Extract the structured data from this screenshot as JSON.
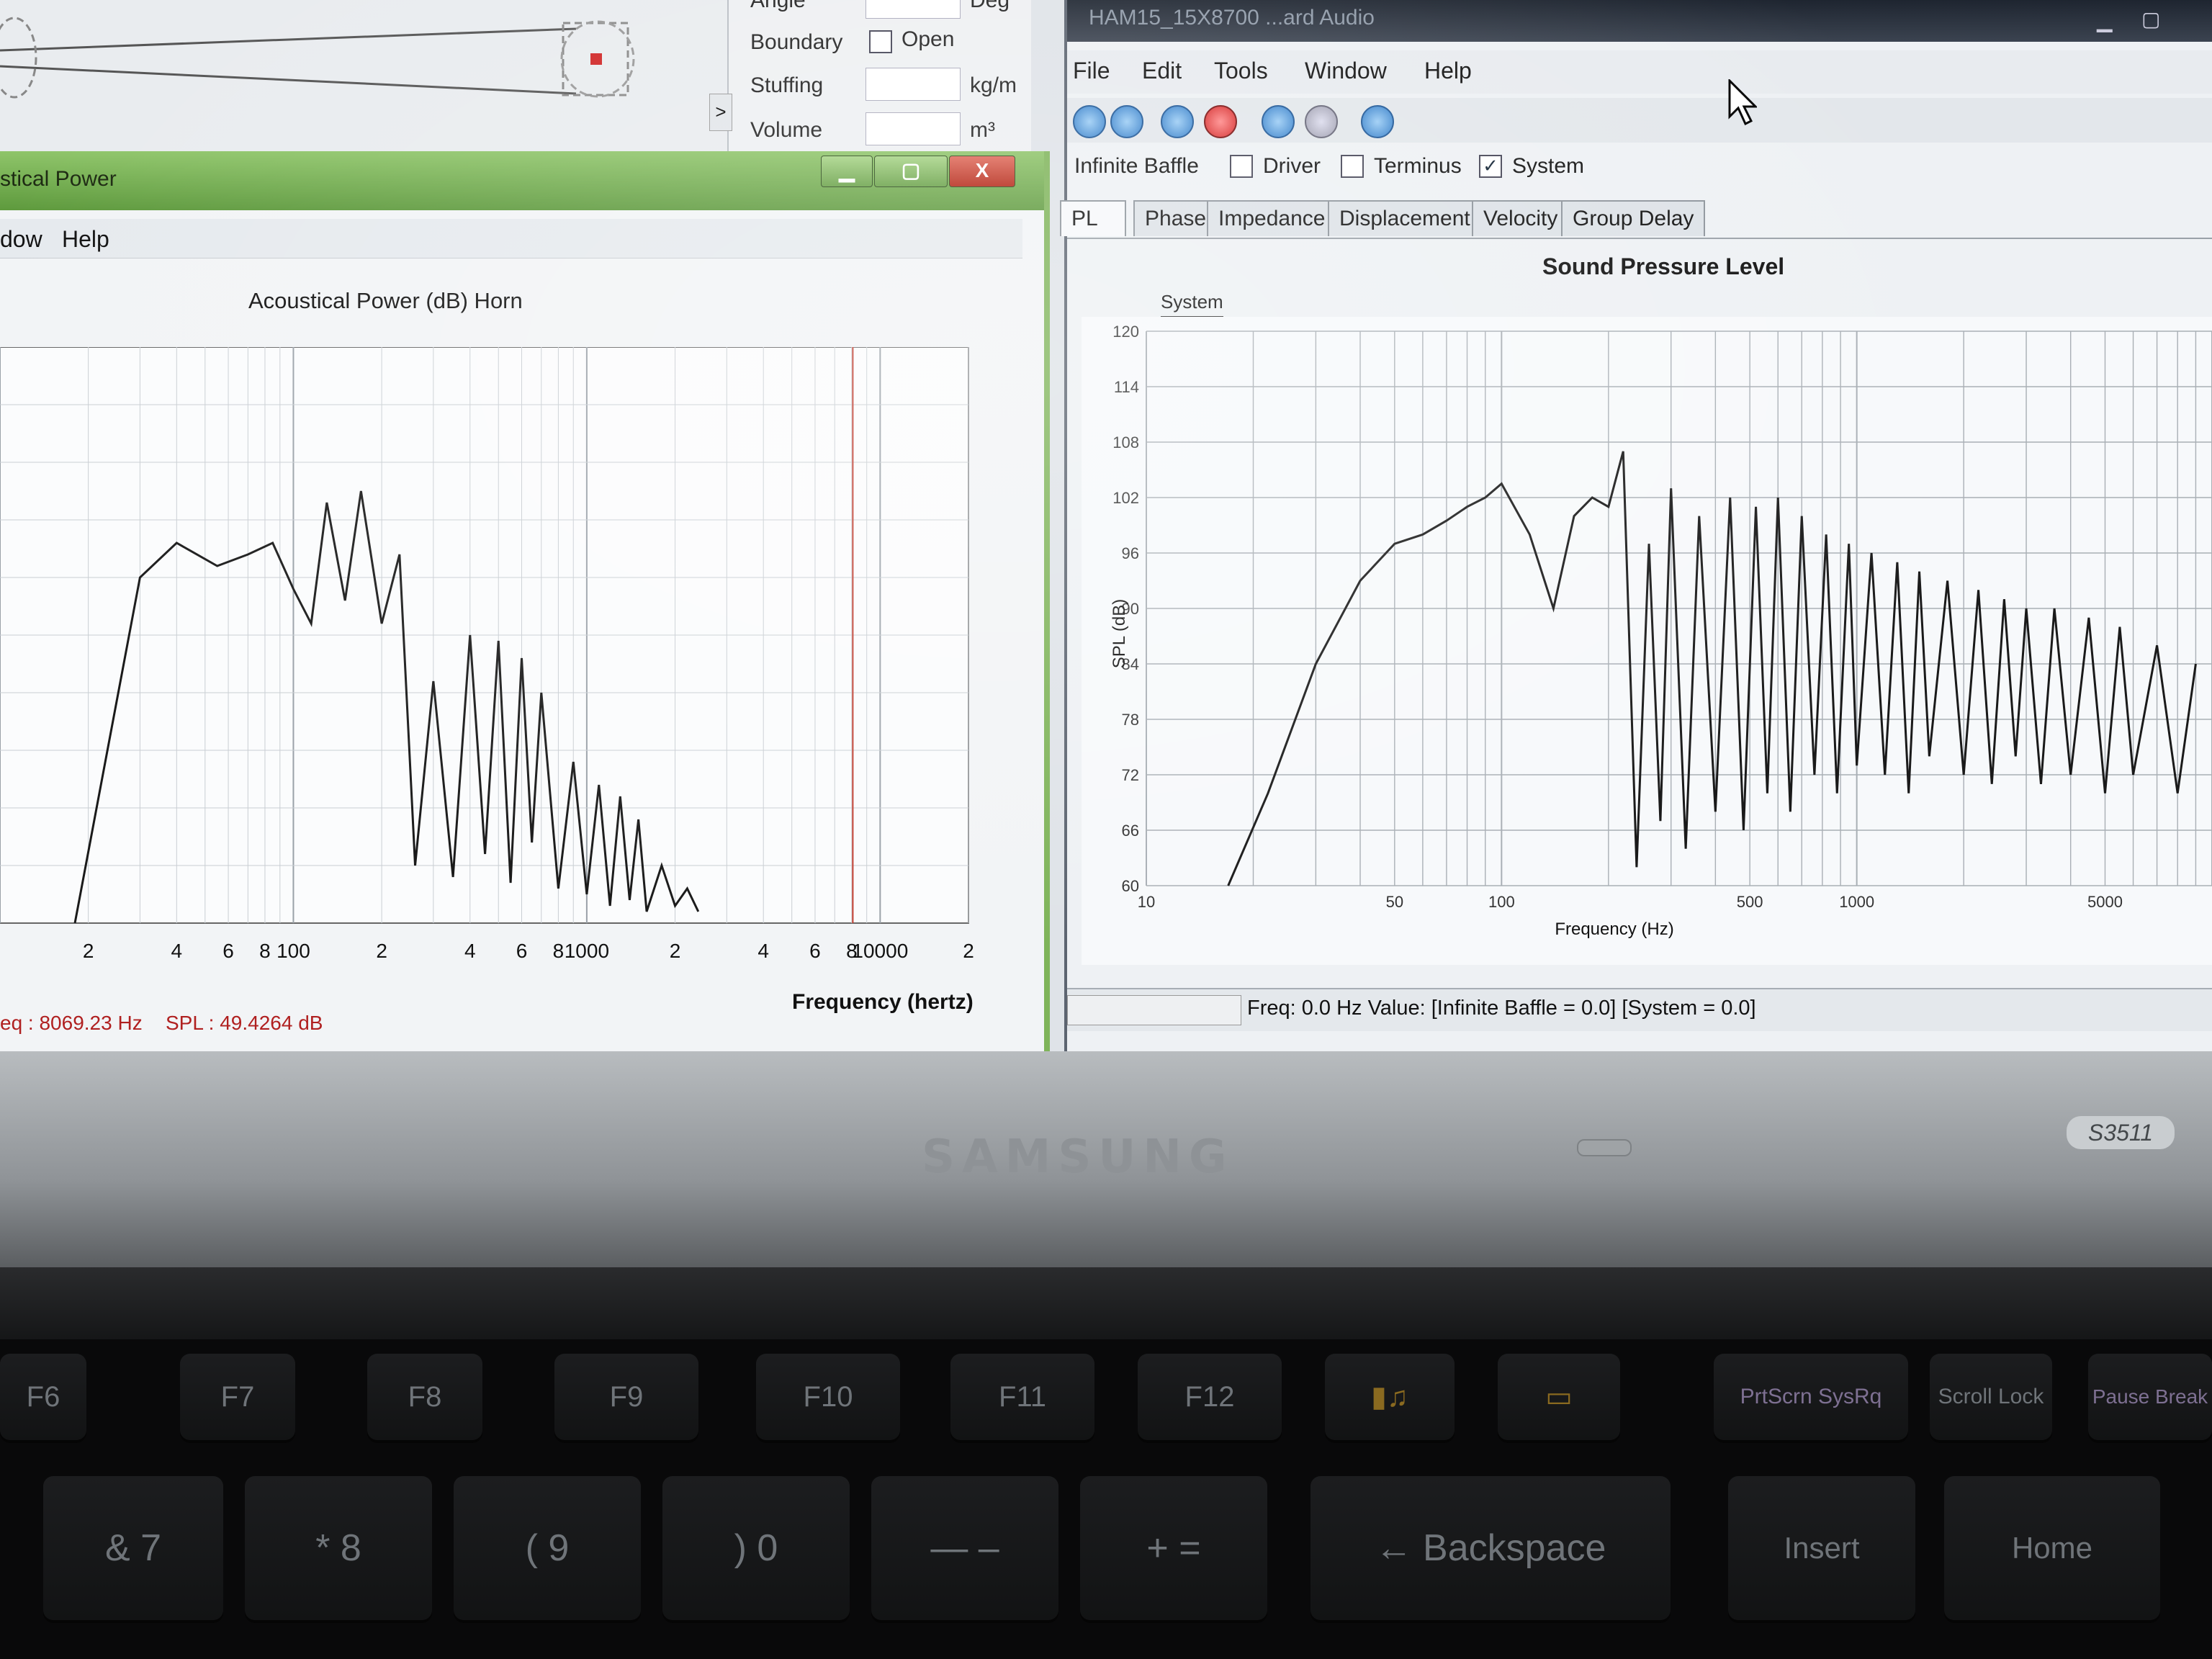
{
  "horn_panel": {
    "rows": [
      {
        "label": "Angle",
        "unit": "Deg"
      },
      {
        "label": "Boundary",
        "checkbox_label": "Open"
      },
      {
        "label": "Stuffing",
        "unit": "kg/m"
      },
      {
        "label": "Volume",
        "unit": "m³"
      }
    ],
    "expand_arrow": ">"
  },
  "ap_window": {
    "title": "stical Power",
    "menu": [
      "dow",
      "Help"
    ],
    "buttons": {
      "minimize": "▁",
      "maximize": "▢",
      "close": "X"
    },
    "plot_title": "Acoustical Power (dB)   Horn",
    "status_freq": "eq : 8069.23 Hz",
    "status_spl": "SPL : 49.4264 dB",
    "xlabel": "Frequency (hertz)",
    "x_ticks": [
      "2",
      "4",
      "6",
      "8",
      "100",
      "2",
      "4",
      "6",
      "8",
      "1000",
      "2",
      "4",
      "6",
      "8",
      "10000",
      "2"
    ],
    "cursor_freq_hz": 8069.23,
    "colors": {
      "curve": "#1a1a1a",
      "cursor_line": "#c0392b",
      "grid": "#b7bdc3"
    }
  },
  "spl_window": {
    "title": "HAM15_15X8700  ...ard Audio",
    "menu": [
      "File",
      "Edit",
      "Tools",
      "Window",
      "Help"
    ],
    "checkboxes": [
      {
        "label": "Infinite Baffle",
        "checked": false
      },
      {
        "label": "Driver",
        "checked": false
      },
      {
        "label": "Terminus",
        "checked": false
      },
      {
        "label": "System",
        "checked": true
      }
    ],
    "tabs": [
      "PL",
      "Phase",
      "Impedance",
      "Displacement",
      "Velocity",
      "Group Delay"
    ],
    "active_tab": "PL",
    "plot_title": "Sound Pressure Level",
    "legend": "System",
    "ylabel": "SPL (dB)",
    "xlabel": "Frequency (Hz)",
    "status": "Freq: 0.0 Hz   Value: [Infinite Baffle = 0.0]   [System = 0.0]",
    "check_mark": "✓"
  },
  "keyboard": {
    "fn_row": [
      "F6",
      "F7",
      "F8",
      "F9",
      "F10",
      "F11",
      "F12",
      "",
      "",
      "PrtScrn SysRq",
      "Scroll Lock",
      "Pause Break"
    ],
    "num_row": [
      "& 7",
      "* 8",
      "( 9",
      ") 0",
      "—  –",
      "+  =",
      "← Backspace",
      "Insert",
      "Home"
    ]
  },
  "bezel": {
    "brand": "SAMSUNG",
    "model": "S3511"
  },
  "chart_data": [
    {
      "type": "line",
      "title": "Acoustical Power (dB)   Horn",
      "xlabel": "Frequency (hertz)",
      "ylabel": "",
      "x_scale": "log",
      "xlim": [
        10,
        20000
      ],
      "ylim": [
        0,
        100
      ],
      "x_ticks": [
        "2",
        "4",
        "6",
        "8",
        "100",
        "2",
        "4",
        "6",
        "8",
        "1000",
        "2",
        "4",
        "6",
        "8",
        "10000",
        "2"
      ],
      "series": [
        {
          "x": [
            18,
            30,
            40,
            55,
            70,
            85,
            100,
            115,
            130,
            150,
            170,
            200,
            230,
            260,
            300,
            350,
            400,
            450,
            500,
            550,
            600,
            650,
            700,
            800,
            900,
            1000,
            1100,
            1200,
            1300,
            1400,
            1500,
            1600,
            1800,
            2000,
            2200,
            2400
          ],
          "y": [
            0,
            60,
            66,
            62,
            64,
            66,
            58,
            52,
            73,
            56,
            75,
            52,
            64,
            10,
            42,
            8,
            50,
            12,
            49,
            7,
            46,
            14,
            40,
            6,
            28,
            5,
            24,
            3,
            22,
            4,
            18,
            2,
            10,
            3,
            6,
            2
          ]
        }
      ],
      "cursor": {
        "x": 8069.23,
        "y": 49.4264
      }
    },
    {
      "type": "line",
      "title": "Sound Pressure Level",
      "xlabel": "Frequency (Hz)",
      "ylabel": "SPL (dB)",
      "x_scale": "log",
      "xlim": [
        10,
        10000
      ],
      "ylim": [
        60,
        120
      ],
      "y_ticks": [
        60,
        66,
        72,
        78,
        84,
        90,
        96,
        102,
        108,
        114,
        120
      ],
      "x_tick_labels": [
        "10",
        "50",
        "100",
        "500",
        "1000",
        "5000"
      ],
      "series": [
        {
          "name": "System",
          "x": [
            17,
            22,
            30,
            40,
            50,
            60,
            70,
            80,
            90,
            100,
            120,
            140,
            160,
            180,
            200,
            220,
            240,
            260,
            280,
            300,
            330,
            360,
            400,
            440,
            480,
            520,
            560,
            600,
            650,
            700,
            760,
            820,
            880,
            950,
            1000,
            1100,
            1200,
            1300,
            1400,
            1500,
            1600,
            1800,
            2000,
            2200,
            2400,
            2600,
            2800,
            3000,
            3300,
            3600,
            4000,
            4500,
            5000,
            5500,
            6000,
            7000,
            8000,
            9000
          ],
          "y": [
            60,
            70,
            84,
            93,
            97,
            98,
            99.5,
            101,
            102,
            103.5,
            98,
            90,
            100,
            102,
            101,
            107,
            62,
            97,
            67,
            103,
            64,
            100,
            68,
            102,
            66,
            101,
            70,
            102,
            68,
            100,
            72,
            98,
            70,
            97,
            73,
            96,
            72,
            95,
            70,
            94,
            74,
            93,
            72,
            92,
            71,
            91,
            74,
            90,
            71,
            90,
            72,
            89,
            70,
            88,
            72,
            86,
            70,
            84
          ]
        }
      ]
    }
  ]
}
